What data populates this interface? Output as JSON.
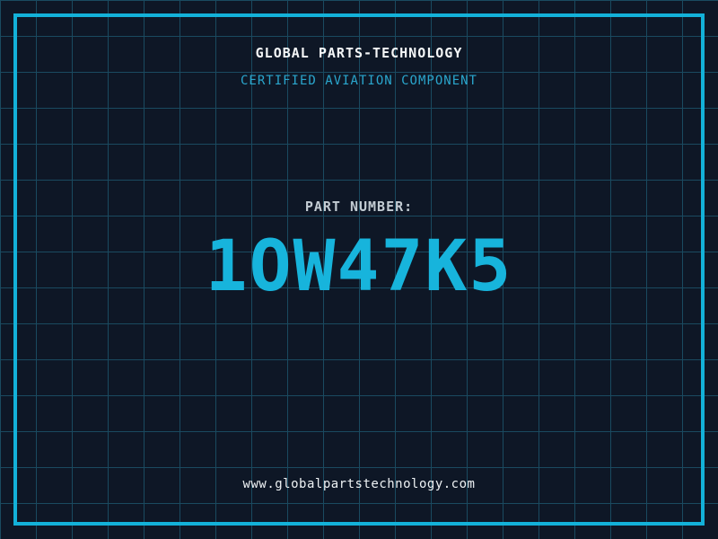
{
  "header": {
    "company_name": "GLOBAL PARTS-TECHNOLOGY",
    "tagline": "CERTIFIED AVIATION COMPONENT"
  },
  "part": {
    "label": "PART NUMBER:",
    "number": "1OW47K5"
  },
  "footer": {
    "website": "www.globalpartstechnology.com"
  },
  "colors": {
    "background": "#0e1726",
    "grid_line": "#1a4a60",
    "frame_border": "#13b1d9",
    "accent_cyan": "#17b4dc",
    "tagline_cyan": "#2aa6cd",
    "text_white": "#f5f7f8",
    "text_gray": "#c3ccd3"
  }
}
